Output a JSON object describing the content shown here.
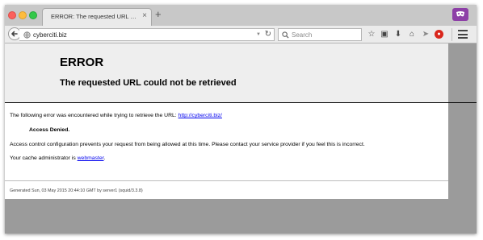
{
  "browser": {
    "tab": {
      "title": "ERROR: The requested URL co...",
      "close": "×"
    },
    "new_tab": "+",
    "url": "cyberciti.biz",
    "search_placeholder": "Search",
    "icons": [
      "globe-icon",
      "back-arrow-icon",
      "reload-icon",
      "search-icon",
      "bookmark-star-icon",
      "library-icon",
      "download-icon",
      "home-icon",
      "send-icon",
      "extension-icon",
      "hamburger-menu-icon",
      "private-mask-icon"
    ]
  },
  "page": {
    "title": "ERROR",
    "subtitle": "The requested URL could not be retrieved",
    "line1_prefix": "The following error was encountered while trying to retrieve the URL: ",
    "line1_link": "http://cyberciti.biz/",
    "line2": "Access Denied.",
    "line3": "Access control configuration prevents your request from being allowed at this time. Please contact your service provider if you feel this is incorrect.",
    "line4_prefix": "Your cache administrator is ",
    "line4_link": "webmaster",
    "line4_suffix": ".",
    "footer": "Generated Sun, 03 May 2015 20:44:10 GMT by server1 (squid/3.3.8)"
  },
  "colors": {
    "link": "#0000ee",
    "header_bg": "#eeeeee",
    "private_badge": "#8d3fa7"
  }
}
